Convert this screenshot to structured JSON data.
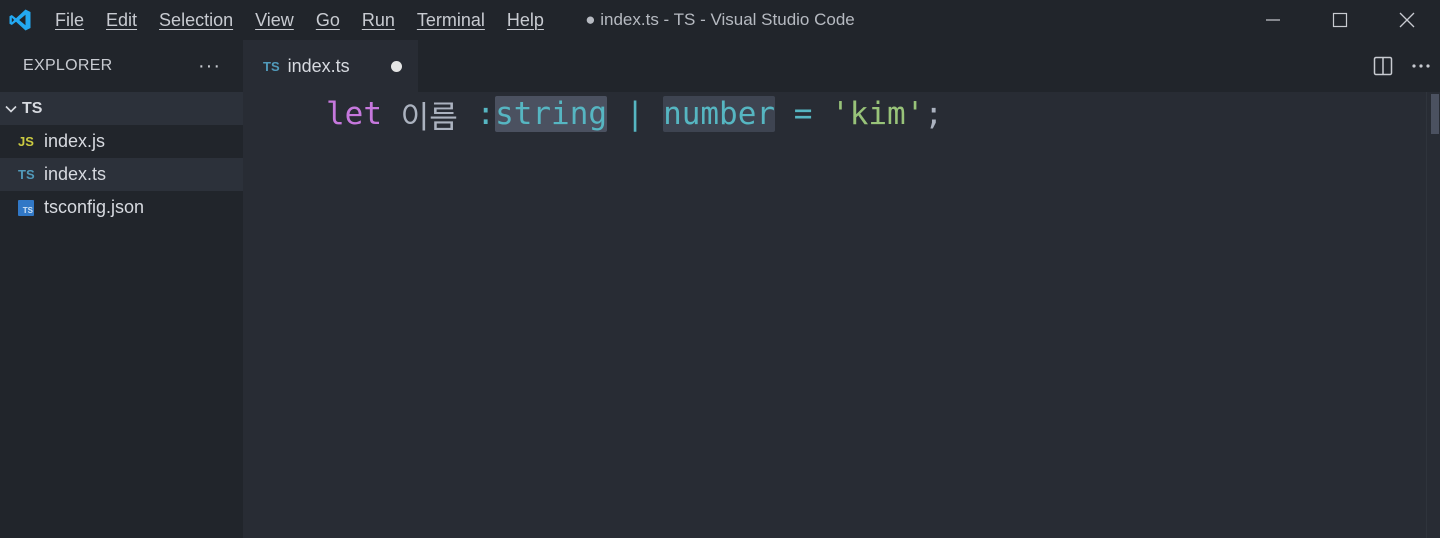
{
  "window": {
    "title": "● index.ts - TS - Visual Studio Code"
  },
  "menu": [
    "File",
    "Edit",
    "Selection",
    "View",
    "Go",
    "Run",
    "Terminal",
    "Help"
  ],
  "sidebar": {
    "title": "EXPLORER",
    "more": "···",
    "folder": "TS",
    "files": [
      {
        "icon_text": "JS",
        "icon_color": "#cbcb41",
        "label": "index.js"
      },
      {
        "icon_text": "TS",
        "icon_color": "#519aba",
        "label": "index.ts"
      },
      {
        "icon_text": "TS",
        "icon_color": "#519aba",
        "label": "tsconfig.json"
      }
    ]
  },
  "tab": {
    "icon_text": "TS",
    "label": "index.ts"
  },
  "editor": {
    "tokens": {
      "kw_let": "let",
      "ident": "이름",
      "colon": ":",
      "type_string": "string",
      "pipe": "|",
      "type_number": "number",
      "equals": "=",
      "str_value": "'kim'",
      "semicolon": ";"
    }
  },
  "colors": {
    "accent_vscode": "#23a9f2",
    "keyword": "#c678dd",
    "type": "#56b6c2",
    "string": "#98c379"
  },
  "icons": {
    "logo": "vscode-logo-icon",
    "minimize": "minimize-icon",
    "maximize": "maximize-icon",
    "close": "close-icon",
    "split": "split-editor-icon",
    "more": "more-actions-icon",
    "chevron": "chevron-down-icon"
  }
}
